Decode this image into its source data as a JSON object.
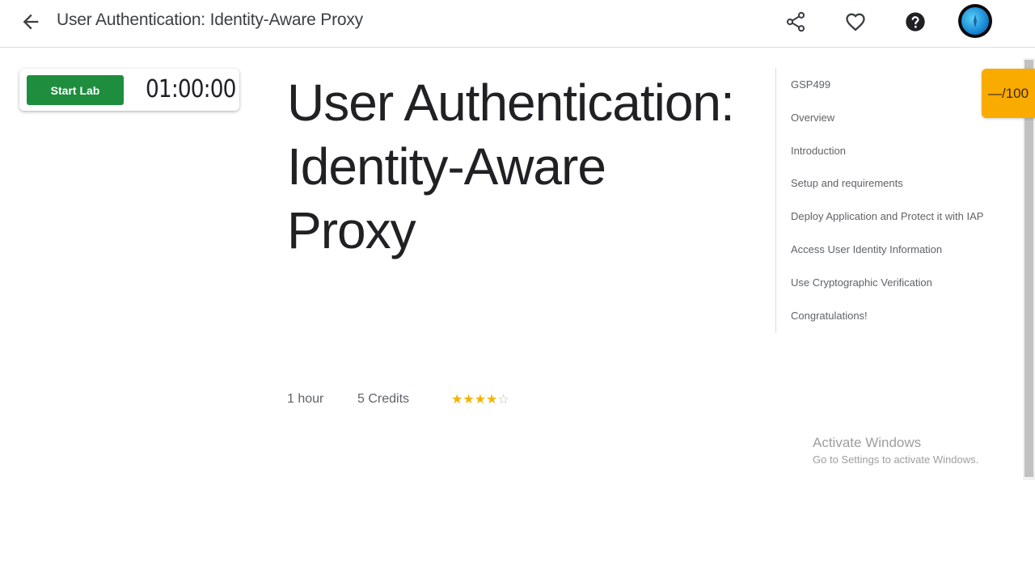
{
  "header": {
    "title": "User Authentication: Identity-Aware Proxy",
    "icons": [
      "arrow-back-icon",
      "share-icon",
      "heart-icon",
      "help-icon",
      "avatar"
    ]
  },
  "lab_card": {
    "start_label": "Start Lab",
    "timer": "01:00:00",
    "accent": "#1e8e3e"
  },
  "main": {
    "title": "User Authentication: Identity-Aware Proxy",
    "duration": "1 hour",
    "credits": "5 Credits",
    "rating": {
      "filled": 4,
      "total": 5,
      "star_color": "#f4b400"
    }
  },
  "toc": {
    "items": [
      "GSP499",
      "Overview",
      "Introduction",
      "Setup and requirements",
      "Deploy Application and Protect it with IAP",
      "Access User Identity Information",
      "Use Cryptographic Verification",
      "Congratulations!"
    ]
  },
  "score": {
    "text": "—/100",
    "color": "#f9ab00"
  },
  "watermark": {
    "line1": "Activate Windows",
    "line2": "Go to Settings to activate Windows."
  }
}
